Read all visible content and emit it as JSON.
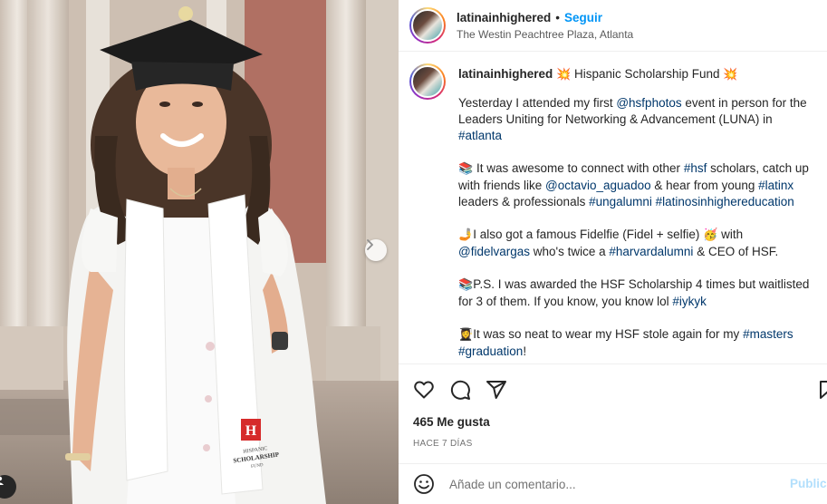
{
  "post": {
    "username": "latinainhighered",
    "separator": "•",
    "follow_label": "Seguir",
    "location": "The Westin Peachtree Plaza, Atlanta"
  },
  "caption": {
    "username": "latinainhighered",
    "title_emoji_left": "💥",
    "title": "Hispanic Scholarship Fund",
    "title_emoji_right": "💥",
    "p1_a": "Yesterday I attended my first ",
    "p1_tag1": "@hsfphotos",
    "p1_b": " event in person for the Leaders Uniting for Networking & Advancement (LUNA) in ",
    "p1_tag2": "#atlanta",
    "p2_emoji": "📚",
    "p2_a": " It was awesome to connect with other ",
    "p2_tag1": "#hsf",
    "p2_b": " scholars, catch up with friends like ",
    "p2_tag2": "@octavio_aguadoo",
    "p2_c": " & hear from young ",
    "p2_tag3": "#latinx",
    "p2_d": " leaders & professionals ",
    "p2_tag4": "#ungalumni",
    "p2_e": " ",
    "p2_tag5": "#latinosinhighereducation",
    "p3_emoji": "🤳",
    "p3_a": "I also got a famous Fidelfie (Fidel + selfie) ",
    "p3_emoji2": "🥳",
    "p3_b": " with ",
    "p3_tag1": "@fidelvargas",
    "p3_c": " who's twice a ",
    "p3_tag2": "#harvardalumni",
    "p3_d": " & CEO of HSF.",
    "p4_emoji": "📚",
    "p4_a": "P.S. I was awarded the HSF Scholarship 4 times but waitlisted for 3 of them. If you know, you know lol ",
    "p4_tag1": "#iykyk",
    "p5_emoji": "👩‍🎓",
    "p5_a": "It was so neat to wear my HSF stole again for my ",
    "p5_tag1": "#masters",
    "p5_b": " ",
    "p5_tag2": "#graduation",
    "p5_c": "!"
  },
  "actions": {
    "icons": [
      "heart-icon",
      "comment-icon",
      "share-icon",
      "bookmark-icon"
    ]
  },
  "likes": "465 Me gusta",
  "timestamp": "HACE 7 DÍAS",
  "comment": {
    "placeholder": "Añade un comentario...",
    "publish_label": "Publicar"
  },
  "stole": {
    "line1": "HISPANIC",
    "line2": "SCHOLARSHIP",
    "line3": "FUND"
  },
  "colors": {
    "link": "#0095f6",
    "hashtag": "#00376b",
    "publish_disabled": "#b2dffc",
    "text": "#262626",
    "muted": "#737373"
  }
}
